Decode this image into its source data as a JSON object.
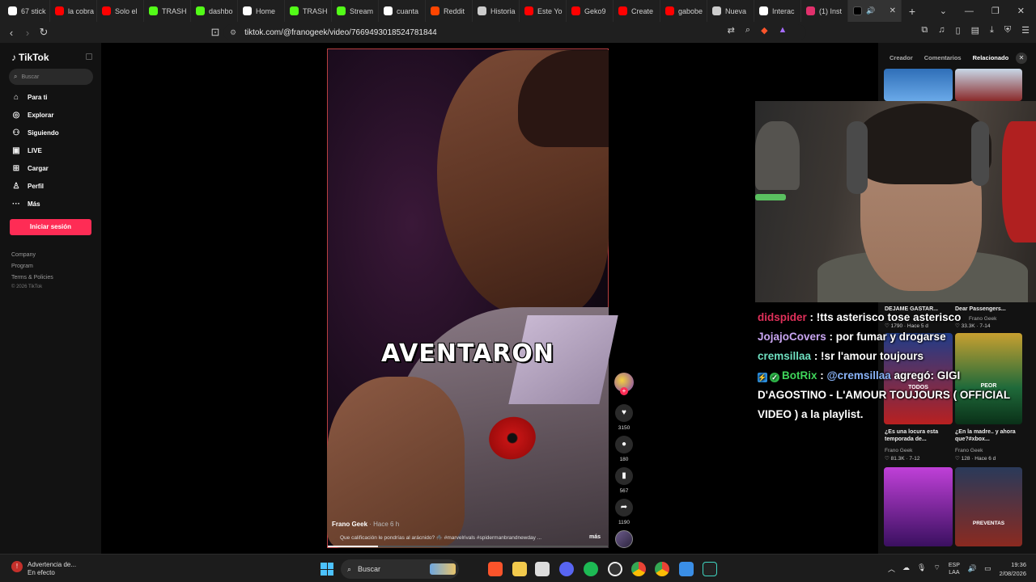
{
  "browser": {
    "tabs": [
      {
        "label": "67 stick",
        "color": "#ffffff"
      },
      {
        "label": "la cobra",
        "color": "#ff0000"
      },
      {
        "label": "Solo el",
        "color": "#ff0000"
      },
      {
        "label": "TRASH",
        "color": "#53fc18"
      },
      {
        "label": "dashbo",
        "color": "#53fc18"
      },
      {
        "label": "Home",
        "color": "#ffffff"
      },
      {
        "label": "TRASH",
        "color": "#53fc18"
      },
      {
        "label": "Stream",
        "color": "#53fc18"
      },
      {
        "label": "cuanta",
        "color": "#ffffff"
      },
      {
        "label": "Reddit",
        "color": "#ff4500"
      },
      {
        "label": "Historia",
        "color": "#cccccc"
      },
      {
        "label": "Este Yo",
        "color": "#ff0000"
      },
      {
        "label": "Geko9",
        "color": "#ff0000"
      },
      {
        "label": "Create",
        "color": "#ff0000"
      },
      {
        "label": "gabobe",
        "color": "#ff0000"
      },
      {
        "label": "Nueva",
        "color": "#cccccc"
      },
      {
        "label": "Interac",
        "color": "#ffffff"
      },
      {
        "label": "(1) Inst",
        "color": "#e1306c"
      }
    ],
    "url": "tiktok.com/@franogeek/video/7669493018524781844"
  },
  "sidebar": {
    "logo": "TikTok",
    "search_placeholder": "Buscar",
    "items": [
      {
        "label": "Para ti",
        "icon": "home-icon"
      },
      {
        "label": "Explorar",
        "icon": "compass-icon"
      },
      {
        "label": "Siguiendo",
        "icon": "following-icon"
      },
      {
        "label": "LIVE",
        "icon": "live-icon"
      },
      {
        "label": "Cargar",
        "icon": "upload-icon"
      },
      {
        "label": "Perfil",
        "icon": "profile-icon"
      },
      {
        "label": "Más",
        "icon": "more-icon"
      }
    ],
    "login_label": "Iniciar sesión",
    "footer": [
      "Company",
      "Program",
      "Terms & Policies"
    ],
    "copyright": "© 2026 TikTok"
  },
  "video": {
    "overlay_text": "AVENTARON",
    "author": "Frano Geek",
    "time": "· Hace 6 h",
    "description": "Que calificación le pondrías al arácnido? 🕷️ #marvelrivals #spidermanbrandnewday ...",
    "more_label": "más",
    "progress": 0.18,
    "likes": "3150",
    "comments": "180",
    "saves": "567",
    "shares": "1190"
  },
  "right_panel": {
    "tabs": [
      "Creador",
      "Comentarios",
      "Relacionado"
    ],
    "active_tab": "Relacionado",
    "videos": [
      {
        "title": "DEJAME GASTAR...",
        "author": "",
        "likes": "1790",
        "date": "Hace 5 d"
      },
      {
        "title": "Dear Passengers...",
        "author": "Frano Geek",
        "likes": "33.3K",
        "date": "7-14"
      },
      {
        "title": "¿Es una locura esta temporada de...",
        "author": "Frano Geek",
        "likes": "81.3K",
        "date": "7-12"
      },
      {
        "title": "¿En la madre.. y ahora que?#xbox...",
        "author": "Frano Geek",
        "likes": "128",
        "date": "Hace 6 d"
      }
    ],
    "thumb_text_todos": "TODOS",
    "thumb_text_peor": "PEOR",
    "thumb_text_preventas": "PREVENTAS"
  },
  "chat": [
    {
      "user": "didspider",
      "message": " : !tts asterisco tose asterisco"
    },
    {
      "user": "JojajoCovers",
      "message": " : por fumar y drogarse"
    },
    {
      "user": "cremsillaa",
      "message": " : !sr l'amour toujours"
    },
    {
      "user": "BotRix",
      "mention": "@cremsillaa",
      "message": " agregó: GIGI D'AGOSTINO - L'AMOUR TOUJOURS ( OFFICIAL VIDEO ) a la playlist."
    }
  ],
  "taskbar": {
    "warning_title": "Advertencia de...",
    "warning_sub": "En efecto",
    "search_label": "Buscar",
    "lang1": "ESP",
    "lang2": "LAA",
    "time": "19:36",
    "date": "2/08/2026"
  }
}
